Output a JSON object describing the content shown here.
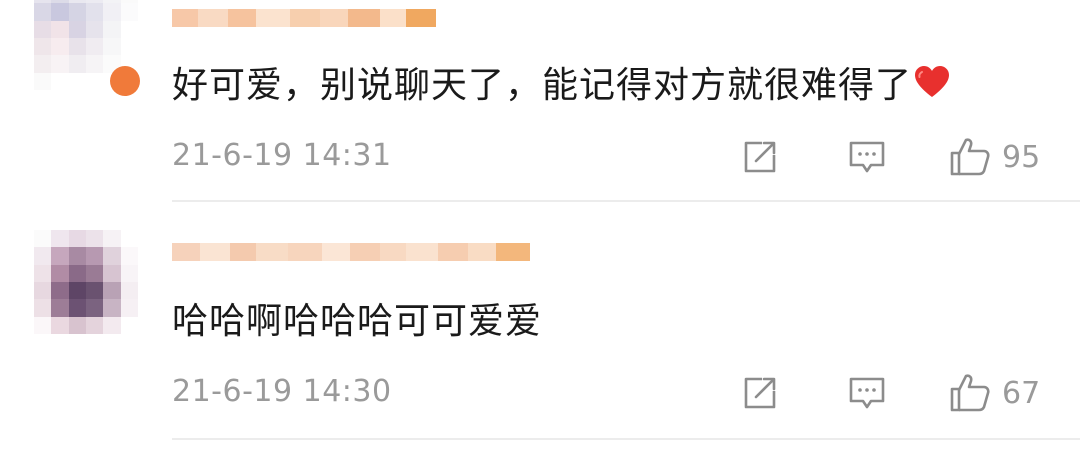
{
  "comments": [
    {
      "text": "好可爱，别说聊天了，能记得对方就很难得了",
      "emoji": "heart-emoji",
      "timestamp": "21-6-19 14:31",
      "like_count": "95",
      "avatar_colors": [
        "#e6e4ee",
        "#dcdbe8",
        "#e9e8f0",
        "#ecebf2",
        "#f3f3f6",
        "#fafafa",
        "#d9d7e6",
        "#c9c8df",
        "#d5d4e4",
        "#e2e1ec",
        "#f1f0f5",
        "#fbfbfc",
        "#e7dde6",
        "#f1e3e8",
        "#d8d3e3",
        "#e6e3ec",
        "#f4f4f6",
        "#ffffff",
        "#efe6ea",
        "#f7ecef",
        "#e8e2ea",
        "#f0ecf1",
        "#f7f7f8",
        "#ffffff",
        "#f3eef0",
        "#f8f3f5",
        "#f0edf1",
        "#f6f4f6",
        "#fbfbfb",
        "#ffffff",
        "#fafafa",
        "#ffffff",
        "#ffffff",
        "#ffffff",
        "#ffffff",
        "#ffffff"
      ],
      "username_colors": [
        "#f7c8a8",
        "#f9dac3",
        "#f6c39e",
        "#fbe3cf",
        "#f7cfae",
        "#f9d6bb",
        "#f3b98c",
        "#fbe0c9",
        "#f0a860"
      ]
    },
    {
      "text": "哈哈啊哈哈哈可可爱爱",
      "timestamp": "21-6-19 14:30",
      "like_count": "67",
      "avatar_colors": [
        "#fbfbfb",
        "#efe6ee",
        "#e7d9e4",
        "#ece2ea",
        "#f6f2f5",
        "#ffffff",
        "#f1e9ef",
        "#c6a7bd",
        "#a88aa3",
        "#b799b1",
        "#e0d2dc",
        "#fbf8fa",
        "#eee2e8",
        "#b18ca5",
        "#8a6a88",
        "#9a7b95",
        "#d7c4d1",
        "#f8f4f7",
        "#e7d8e0",
        "#8e6c8a",
        "#5e4566",
        "#6a5270",
        "#b9a2b5",
        "#f4eef2",
        "#ede0e6",
        "#9d7d97",
        "#6c5273",
        "#7b6380",
        "#c8b4c4",
        "#f6f0f4",
        "#fbf7f9",
        "#ead8e0",
        "#d8c3cf",
        "#e4d3dc",
        "#f3eaef",
        "#ffffff"
      ],
      "username_colors": [
        "#f6d2bb",
        "#fae4d3",
        "#f4caae",
        "#f8dcc6",
        "#f7d5bd",
        "#fbe6d6",
        "#f6cfb4",
        "#f8d9c2",
        "#fae2cf",
        "#f6cdb0",
        "#f9dcc4",
        "#f3b77c"
      ]
    }
  ],
  "colors": {
    "text": "#1a1a1a",
    "meta": "#9a9a9a",
    "divider": "#ececec",
    "heart": "#e8302e",
    "badge": "#f07a3a"
  }
}
